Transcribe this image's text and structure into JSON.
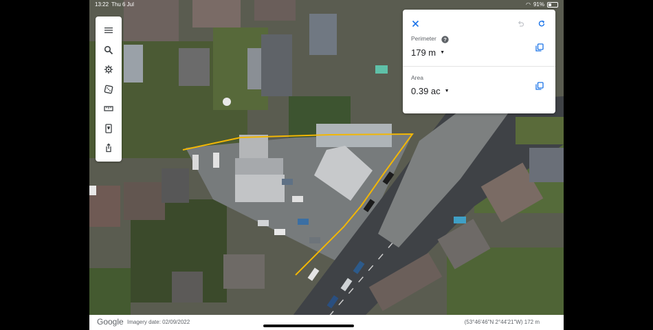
{
  "status_bar": {
    "time": "13:22",
    "date": "Thu 6 Jul",
    "battery": "91%"
  },
  "toolbar": {
    "items": [
      {
        "name": "menu-button",
        "icon": "menu-icon"
      },
      {
        "name": "search-button",
        "icon": "search-icon"
      },
      {
        "name": "voyager-button",
        "icon": "helm-icon"
      },
      {
        "name": "feeling-lucky-button",
        "icon": "dice-icon"
      },
      {
        "name": "measure-button",
        "icon": "ruler-icon"
      },
      {
        "name": "projects-button",
        "icon": "projects-icon"
      },
      {
        "name": "share-button",
        "icon": "share-icon"
      }
    ]
  },
  "measure_panel": {
    "perimeter_label": "Perimeter",
    "perimeter_value": "179 m",
    "area_label": "Area",
    "area_value": "0.39 ac"
  },
  "bottom_bar": {
    "logo": "Google",
    "imagery_date": "Imagery date: 02/09/2022",
    "coordinates": "(53°46'46\"N 2°44'21\"W) 172 m"
  },
  "colors": {
    "accent": "#1a73e8",
    "measure_line": "#f2b705",
    "road": "#3f4246"
  }
}
